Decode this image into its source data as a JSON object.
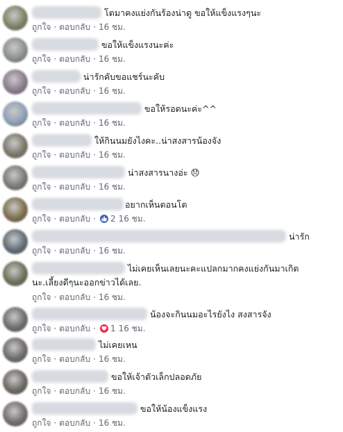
{
  "actions": {
    "like": "ถูกใจ",
    "reply": "ตอบกลับ",
    "sep": "·"
  },
  "colors": {
    "like": "#4267b2",
    "love": "#f0284a",
    "meta": "#616770"
  },
  "comments": [
    {
      "text": "โตมาคงแย่งกันร้องน่าดู ขอให้แข็งแรงๆนะ",
      "text2": "",
      "time": "16 ชม.",
      "reaction": null
    },
    {
      "text": "ขอให้แข็งแรงนะค่ะ",
      "text2": "",
      "time": "16 ชม.",
      "reaction": null
    },
    {
      "text": "น่ารักคับขอแชร์นะคับ",
      "text2": "",
      "time": "16 ชม.",
      "reaction": null
    },
    {
      "text": "ขอให้รอดนะค่ะ^^",
      "text2": "",
      "time": "16 ชม.",
      "reaction": null
    },
    {
      "text": "ให้กินนมยังไงคะ..น่าสงสารน้องจัง",
      "text2": "",
      "time": "16 ชม.",
      "reaction": null
    },
    {
      "text": "น่าสงสารนางอ่ะ 😞",
      "text2": "",
      "time": "16 ชม.",
      "reaction": null
    },
    {
      "text": "อยากเห็นตอนโต",
      "text2": "",
      "time": "16 ชม.",
      "reaction": {
        "icon": "like-icon",
        "count": "2"
      }
    },
    {
      "text": "น่ารัก",
      "text2": "",
      "time": "16 ชม.",
      "reaction": null
    },
    {
      "text": "ไม่เคยเห็นเลยนะคะแปลกมากคงแย่งกันมาเกิด",
      "text2": "นะ.เลี้ยงดีๆนะออกข่าวได้เลย.",
      "time": "16 ชม.",
      "reaction": null
    },
    {
      "text": "น้องจะกินนมอะไรยังไง สงสารจัง",
      "text2": "",
      "time": "16 ชม.",
      "reaction": {
        "icon": "love-icon",
        "count": "1"
      }
    },
    {
      "text": "ไม่เคยเหน",
      "text2": "",
      "time": "16 ชม.",
      "reaction": null
    },
    {
      "text": "ขอให้เจ้าตัวเล็กปลอดภัย",
      "text2": "",
      "time": "16 ชม.",
      "reaction": null
    },
    {
      "text": "ขอให้น้องแข็งแรง",
      "text2": "",
      "time": "16 ชม.",
      "reaction": null
    }
  ]
}
